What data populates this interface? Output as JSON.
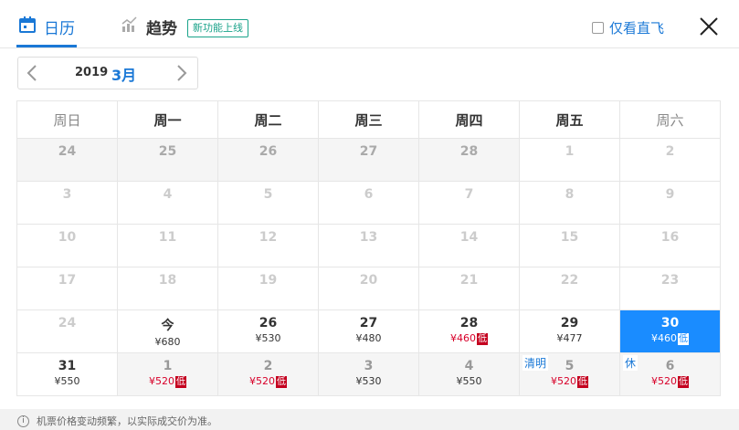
{
  "tabs": {
    "calendar_label": "日历",
    "trend_label": "趋势",
    "new_badge": "新功能上线"
  },
  "only_direct_label": "仅看直飞",
  "month_nav": {
    "year": "2019",
    "month": "3月"
  },
  "weekdays": [
    "周日",
    "周一",
    "周二",
    "周三",
    "周四",
    "周五",
    "周六"
  ],
  "rows": [
    [
      {
        "day": "24",
        "state": "prev"
      },
      {
        "day": "25",
        "state": "prev"
      },
      {
        "day": "26",
        "state": "prev"
      },
      {
        "day": "27",
        "state": "prev"
      },
      {
        "day": "28",
        "state": "prev"
      },
      {
        "day": "1",
        "state": "past"
      },
      {
        "day": "2",
        "state": "past"
      }
    ],
    [
      {
        "day": "3",
        "state": "past"
      },
      {
        "day": "4",
        "state": "past"
      },
      {
        "day": "5",
        "state": "past"
      },
      {
        "day": "6",
        "state": "past"
      },
      {
        "day": "7",
        "state": "past"
      },
      {
        "day": "8",
        "state": "past"
      },
      {
        "day": "9",
        "state": "past"
      }
    ],
    [
      {
        "day": "10",
        "state": "past"
      },
      {
        "day": "11",
        "state": "past"
      },
      {
        "day": "12",
        "state": "past"
      },
      {
        "day": "13",
        "state": "past"
      },
      {
        "day": "14",
        "state": "past"
      },
      {
        "day": "15",
        "state": "past"
      },
      {
        "day": "16",
        "state": "past"
      }
    ],
    [
      {
        "day": "17",
        "state": "past"
      },
      {
        "day": "18",
        "state": "past"
      },
      {
        "day": "19",
        "state": "past"
      },
      {
        "day": "20",
        "state": "past"
      },
      {
        "day": "21",
        "state": "past"
      },
      {
        "day": "22",
        "state": "past"
      },
      {
        "day": "23",
        "state": "past"
      }
    ],
    [
      {
        "day": "24",
        "state": "past"
      },
      {
        "day": "今",
        "state": "active",
        "price": "¥680"
      },
      {
        "day": "26",
        "state": "active",
        "price": "¥530"
      },
      {
        "day": "27",
        "state": "active",
        "price": "¥480"
      },
      {
        "day": "28",
        "state": "active",
        "price": "¥460",
        "low": "低"
      },
      {
        "day": "29",
        "state": "active",
        "price": "¥477"
      },
      {
        "day": "30",
        "state": "selected",
        "price": "¥460",
        "low": "低"
      }
    ],
    [
      {
        "day": "31",
        "state": "active",
        "price": "¥550"
      },
      {
        "day": "1",
        "state": "next",
        "price": "¥520",
        "low": "低"
      },
      {
        "day": "2",
        "state": "next",
        "price": "¥520",
        "low": "低"
      },
      {
        "day": "3",
        "state": "next",
        "price": "¥530"
      },
      {
        "day": "4",
        "state": "next",
        "price": "¥550"
      },
      {
        "day": "5",
        "state": "next",
        "price": "¥520",
        "low": "低",
        "holiday": "清明"
      },
      {
        "day": "6",
        "state": "next",
        "price": "¥520",
        "low": "低",
        "holiday": "休"
      }
    ]
  ],
  "footer_note": "机票价格变动频繁，以实际成交价为准。",
  "colors": {
    "accent": "#1a78d6",
    "selected": "#1a8cff",
    "low_price": "#d8002a",
    "badge": "#1aa38a"
  }
}
